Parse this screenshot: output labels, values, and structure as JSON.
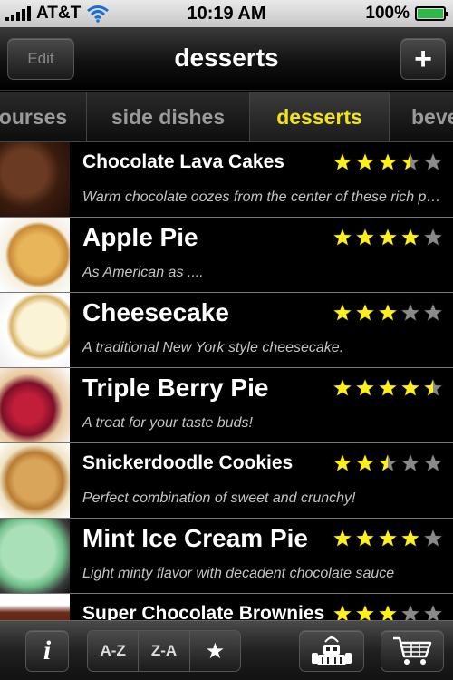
{
  "status_bar": {
    "carrier": "AT&T",
    "time": "10:19 AM",
    "battery": "100%"
  },
  "nav": {
    "edit_label": "Edit",
    "title": "desserts",
    "add_label": "+"
  },
  "tabs": [
    "ourses",
    "side dishes",
    "desserts",
    "beve"
  ],
  "selected_tab": "desserts",
  "recipes": [
    {
      "title": "Chocolate Lava Cakes",
      "description": "Warm chocolate oozes from the center of these rich pers…",
      "rating": 3.5
    },
    {
      "title": "Apple Pie",
      "description": "As American as ....",
      "rating": 4
    },
    {
      "title": "Cheesecake",
      "description": "A traditional New York style cheesecake.",
      "rating": 3
    },
    {
      "title": "Triple Berry Pie",
      "description": "A treat for your taste buds!",
      "rating": 4.5
    },
    {
      "title": "Snickerdoodle Cookies",
      "description": "Perfect combination of sweet and crunchy!",
      "rating": 2.5
    },
    {
      "title": "Mint Ice Cream Pie",
      "description": "Light minty flavor with decadent chocolate sauce",
      "rating": 4
    },
    {
      "title": "Super Chocolate Brownies",
      "description": "",
      "rating": 3
    }
  ],
  "toolbar": {
    "info_label": "i",
    "sort_az": "A-Z",
    "sort_za": "Z-A",
    "sort_rating": "★"
  },
  "colors": {
    "accent": "#f2e21a",
    "star_filled": "#ffef1c",
    "star_empty": "#8a8a8a",
    "battery_fill": "#2fb84a"
  },
  "icons": {
    "carrier_signal": "signal-bars-icon",
    "wifi": "wifi-icon",
    "battery": "battery-icon",
    "robot": "robot-icon",
    "cart": "shopping-cart-icon"
  }
}
